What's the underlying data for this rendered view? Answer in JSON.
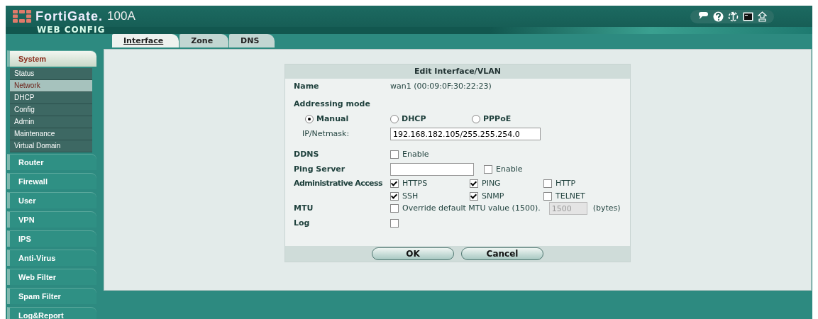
{
  "header": {
    "brand": "FortiGate.",
    "model": "100A",
    "subtitle": "WEB CONFIG"
  },
  "tabs": [
    {
      "label": "Interface",
      "selected": true
    },
    {
      "label": "Zone",
      "selected": false
    },
    {
      "label": "DNS",
      "selected": false
    }
  ],
  "sidebar": {
    "items": [
      {
        "label": "System",
        "expanded": true,
        "children": [
          {
            "label": "Status",
            "selected": false
          },
          {
            "label": "Network",
            "selected": true
          },
          {
            "label": "DHCP",
            "selected": false
          },
          {
            "label": "Config",
            "selected": false
          },
          {
            "label": "Admin",
            "selected": false
          },
          {
            "label": "Maintenance",
            "selected": false
          },
          {
            "label": "Virtual Domain",
            "selected": false
          }
        ]
      },
      {
        "label": "Router",
        "expanded": false
      },
      {
        "label": "Firewall",
        "expanded": false
      },
      {
        "label": "User",
        "expanded": false
      },
      {
        "label": "VPN",
        "expanded": false
      },
      {
        "label": "IPS",
        "expanded": false
      },
      {
        "label": "Anti-Virus",
        "expanded": false
      },
      {
        "label": "Web Filter",
        "expanded": false
      },
      {
        "label": "Spam Filter",
        "expanded": false
      },
      {
        "label": "Log&Report",
        "expanded": false
      }
    ]
  },
  "dialog": {
    "title": "Edit Interface/VLAN",
    "name": {
      "label": "Name",
      "value": "wan1 (00:09:0F:30:22:23)"
    },
    "addressing": {
      "label": "Addressing mode",
      "options": [
        {
          "label": "Manual",
          "selected": true
        },
        {
          "label": "DHCP",
          "selected": false
        },
        {
          "label": "PPPoE",
          "selected": false
        }
      ],
      "ip_label": "IP/Netmask:",
      "ip_value": "192.168.182.105/255.255.254.0"
    },
    "ddns": {
      "label": "DDNS",
      "option": {
        "label": "Enable",
        "checked": false
      }
    },
    "ping_server": {
      "label": "Ping Server",
      "option": {
        "label": "Enable",
        "checked": false
      }
    },
    "admin_access": {
      "label": "Administrative Access",
      "options": [
        {
          "label": "HTTPS",
          "checked": true
        },
        {
          "label": "PING",
          "checked": true
        },
        {
          "label": "HTTP",
          "checked": false
        },
        {
          "label": "SSH",
          "checked": true
        },
        {
          "label": "SNMP",
          "checked": true
        },
        {
          "label": "TELNET",
          "checked": false
        }
      ]
    },
    "mtu": {
      "label": "MTU",
      "option": {
        "label": "Override default MTU value (1500).",
        "checked": false
      },
      "value": "1500",
      "disabled": true,
      "unit": "(bytes)"
    },
    "log": {
      "label": "Log",
      "checked": false
    },
    "buttons": [
      "OK",
      "Cancel"
    ]
  }
}
